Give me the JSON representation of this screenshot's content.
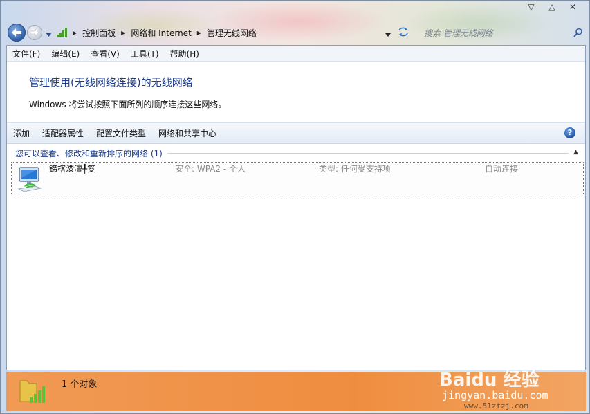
{
  "window": {
    "caption_buttons": {
      "minimize": "▽",
      "maximize": "△",
      "close": "✕"
    }
  },
  "address_bar": {
    "crumbs": [
      "控制面板",
      "网络和 Internet",
      "管理无线网络"
    ],
    "search_placeholder": "搜索 管理无线网络"
  },
  "menu": {
    "items": [
      "文件(F)",
      "编辑(E)",
      "查看(V)",
      "工具(T)",
      "帮助(H)"
    ]
  },
  "main": {
    "title": "管理使用(无线网络连接)的无线网络",
    "description": "Windows 将尝试按照下面所列的顺序连接这些网络。"
  },
  "commands": {
    "items": [
      "添加",
      "适配器属性",
      "配置文件类型",
      "网络和共享中心"
    ],
    "help": "?"
  },
  "group": {
    "header": "您可以查看、修改和重新排序的网络 (1)",
    "collapse": "▲"
  },
  "networks": [
    {
      "name": "鍗楁潥澶╀笅",
      "security": "安全: WPA2 - 个人",
      "type": "类型: 任何受支持项",
      "mode": "自动连接"
    }
  ],
  "status": {
    "count_text": "1 个对象"
  },
  "watermark": {
    "brand": "Baidu 经验",
    "url": "jingyan.baidu.com",
    "url2": "www.51ztzj.com"
  },
  "colors": {
    "accent_text": "#1e3f8f",
    "status_bar": "#ef8d3f"
  }
}
